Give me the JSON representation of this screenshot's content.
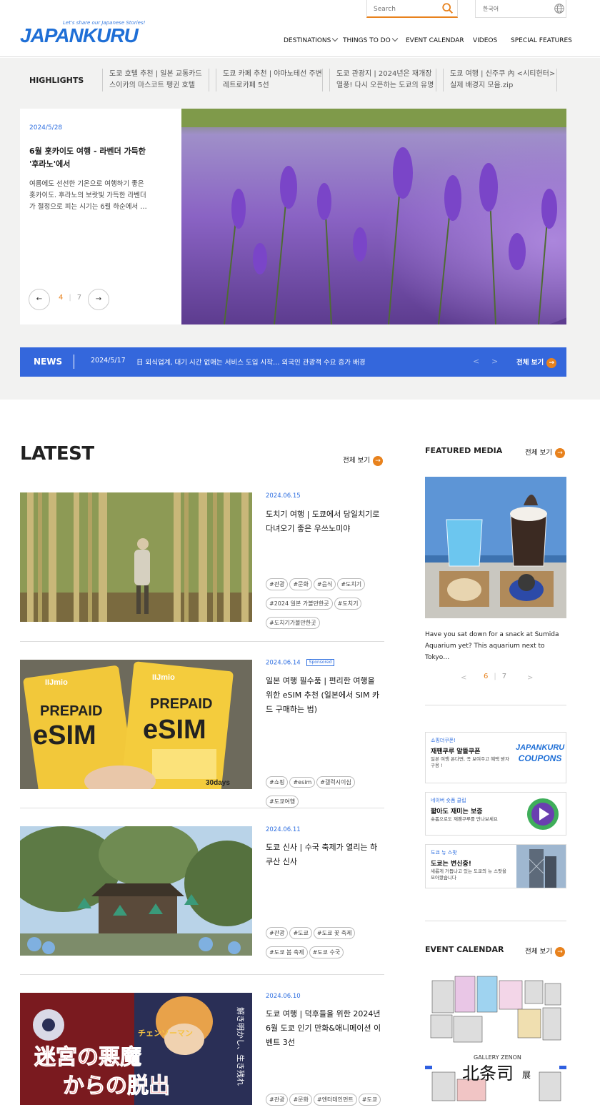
{
  "header": {
    "logo_text": "JAPANKURU",
    "logo_tagline": "Let's share our Japanese Stories!",
    "search_placeholder": "Search",
    "language": "한국어",
    "nav": [
      "DESTINATIONS",
      "THINGS TO DO",
      "EVENT CALENDAR",
      "VIDEOS",
      "SPECIAL FEATURES"
    ]
  },
  "highlights": {
    "label": "HIGHLIGHTS",
    "items": [
      "도쿄 호텔 추천 | 일본 교통카드 스이카의 마스코트 펭귄 호텔",
      "도쿄 카페 추천 | 야마노테선 주변 레트로카페 5선",
      "도쿄 관광지 | 2024년은 재개장 열풍! 다시 오픈하는 도쿄의 유명 …",
      "도쿄 여행 | 신주쿠 內 <시티헌터> 실제 배경지 모음.zip"
    ]
  },
  "hero": {
    "date": "2024/5/28",
    "title": "6월 홋카이도 여행 - 라벤더 가득한 '후라노'에서",
    "desc": "여름에도 선선한 기온으로 여행하기 좋은 홋카이도. 후라노의 보랏빛 가득한 라벤더가 절정으로 피는 시기는 6월 하순에서 …",
    "page_current": "4",
    "page_total": "7",
    "prev": "←",
    "next": "→"
  },
  "news": {
    "label": "NEWS",
    "date": "2024/5/17",
    "text": "日 외식업계, 대기 시간 없애는 서비스 도입 시작… 외국인 관광객 수요 증가 배경",
    "prev": "<",
    "next": ">",
    "see_all": "전체 보기"
  },
  "latest": {
    "title": "LATEST",
    "see_all": "전체 보기",
    "sponsored_label": "Sponsored",
    "articles": [
      {
        "date": "2024.06.15",
        "title": "도치기 여행 | 도쿄에서 당일치기로 다녀오기 좋은 우쓰노미야",
        "tags": [
          "#관광",
          "#문화",
          "#음식",
          "#도치기",
          "#2024 일본 가볼만한곳",
          "#도치기",
          "#도치기가볼만한곳"
        ]
      },
      {
        "date": "2024.06.14",
        "title": "일본 여행 필수품 | 편리한 여행을 위한 eSIM 추천 (일본에서 SIM 카드 구매하는 법)",
        "tags": [
          "#쇼핑",
          "#esim",
          "#갤럭시이심",
          "#도쿄여행"
        ],
        "image_text": [
          "IIJmio",
          "PREPAID",
          "eSIM",
          "30days"
        ]
      },
      {
        "date": "2024.06.11",
        "title": "도쿄 신사 | 수국 축제가 열리는 하쿠산 신사",
        "tags": [
          "#관광",
          "#도쿄",
          "#도쿄 꽃 축제",
          "#도쿄 봄 축제",
          "#도쿄 수국"
        ]
      },
      {
        "date": "2024.06.10",
        "title": "도쿄 여행 | 덕후들을 위한 2024년 6월 도쿄 인기 만화&애니메이션 이벤트 3선",
        "tags": [
          "#관광",
          "#문화",
          "#엔터테인먼트",
          "#도쿄"
        ],
        "image_text": [
          "チェンソーマン",
          "迷宮の悪魔",
          "からの脱出",
          "解き明かし、生き残れ"
        ]
      }
    ]
  },
  "featured_media": {
    "title": "FEATURED MEDIA",
    "see_all": "전체 보기",
    "caption": "Have you sat down for a snack at Sumida Aquarium yet? This aquarium next to Tokyo…",
    "page_current": "6",
    "page_total": "7",
    "prev": "<",
    "next": ">"
  },
  "banners": [
    {
      "tag": "쇼핑더쿠폰!",
      "title": "재팬쿠루 알뜰쿠폰",
      "sub": "일본 여행 온다면, 꼭 보여주고 혜택 받자구용 !",
      "logo": [
        "JAPANKURU",
        "COUPONS"
      ]
    },
    {
      "tag": "네이버 숏폼 클립",
      "title": "짧아도 재미는 보증",
      "sub": "숏폼으로도 재팬쿠루를 만나보세요"
    },
    {
      "tag": "도쿄 뉴 스팟",
      "title": "도쿄는 변신중!",
      "sub": "새롭게 거듭나고 있는 도쿄의 뉴 스팟을 모아봤습니다"
    }
  ],
  "event_calendar": {
    "title": "EVENT CALENDAR",
    "see_all": "전체 보기",
    "poster_text": [
      "GALLERY ZENON",
      "北条司",
      "展"
    ]
  },
  "colors": {
    "accent_orange": "#e8821d",
    "brand_blue": "#3467dc",
    "date_blue": "#2f6fe0"
  }
}
